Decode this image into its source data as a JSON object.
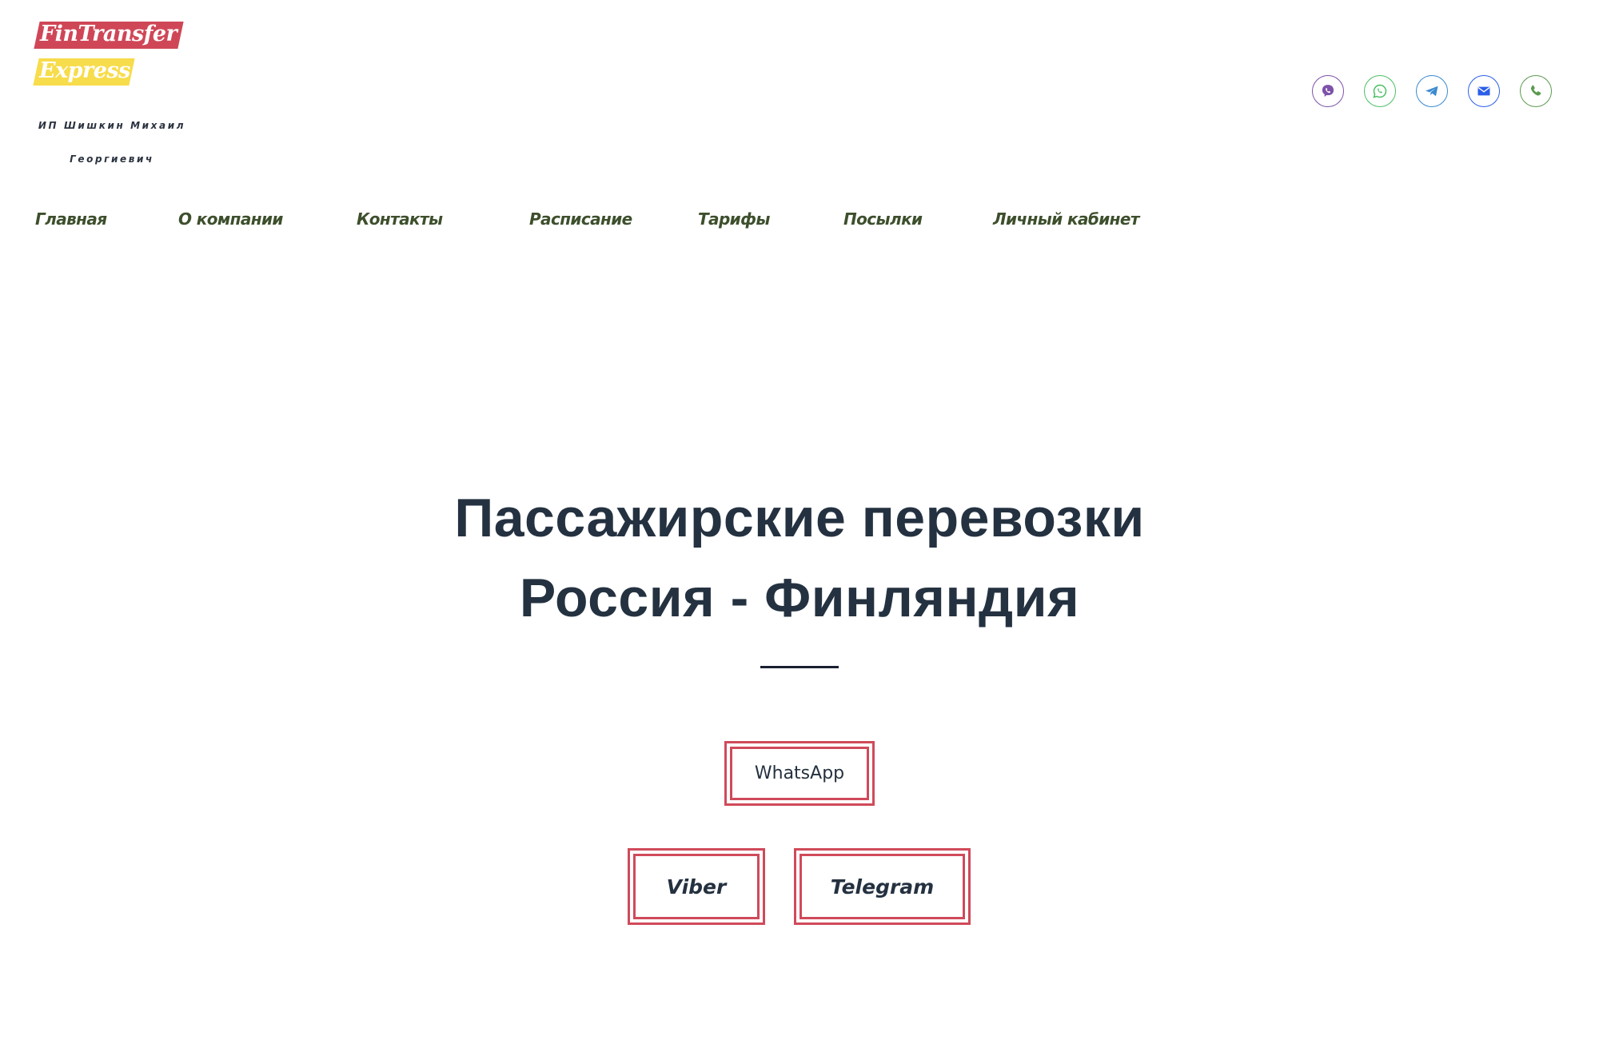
{
  "logo": {
    "line1": "FinTransfer",
    "line2": "Express",
    "colors": {
      "red": "#cf4757",
      "yellow": "#f7dc4b"
    }
  },
  "owner": {
    "line1": "ИП Шишкин Михаил",
    "line2": "Георгиевич"
  },
  "contacts": [
    {
      "name": "viber",
      "icon": "viber-icon",
      "color": "#7d52a8"
    },
    {
      "name": "whatsapp",
      "icon": "whatsapp-icon",
      "color": "#4cc064"
    },
    {
      "name": "telegram",
      "icon": "telegram-icon",
      "color": "#3a8ad0"
    },
    {
      "name": "email",
      "icon": "mail-icon",
      "color": "#2c5fe8"
    },
    {
      "name": "phone",
      "icon": "phone-icon",
      "color": "#5a9a4e"
    }
  ],
  "nav": {
    "items": [
      {
        "label": "Главная"
      },
      {
        "label": "О компании"
      },
      {
        "label": "Контакты"
      },
      {
        "label": "Расписание"
      },
      {
        "label": "Тарифы"
      },
      {
        "label": "Посылки"
      },
      {
        "label": "Личный кабинет"
      }
    ]
  },
  "hero": {
    "title_line1": "Пассажирские перевозки",
    "title_line2": "Россия - Финляндия",
    "buttons": {
      "whatsapp": "WhatsApp",
      "viber": "Viber",
      "telegram": "Telegram"
    },
    "accent_color": "#d04a5a"
  }
}
